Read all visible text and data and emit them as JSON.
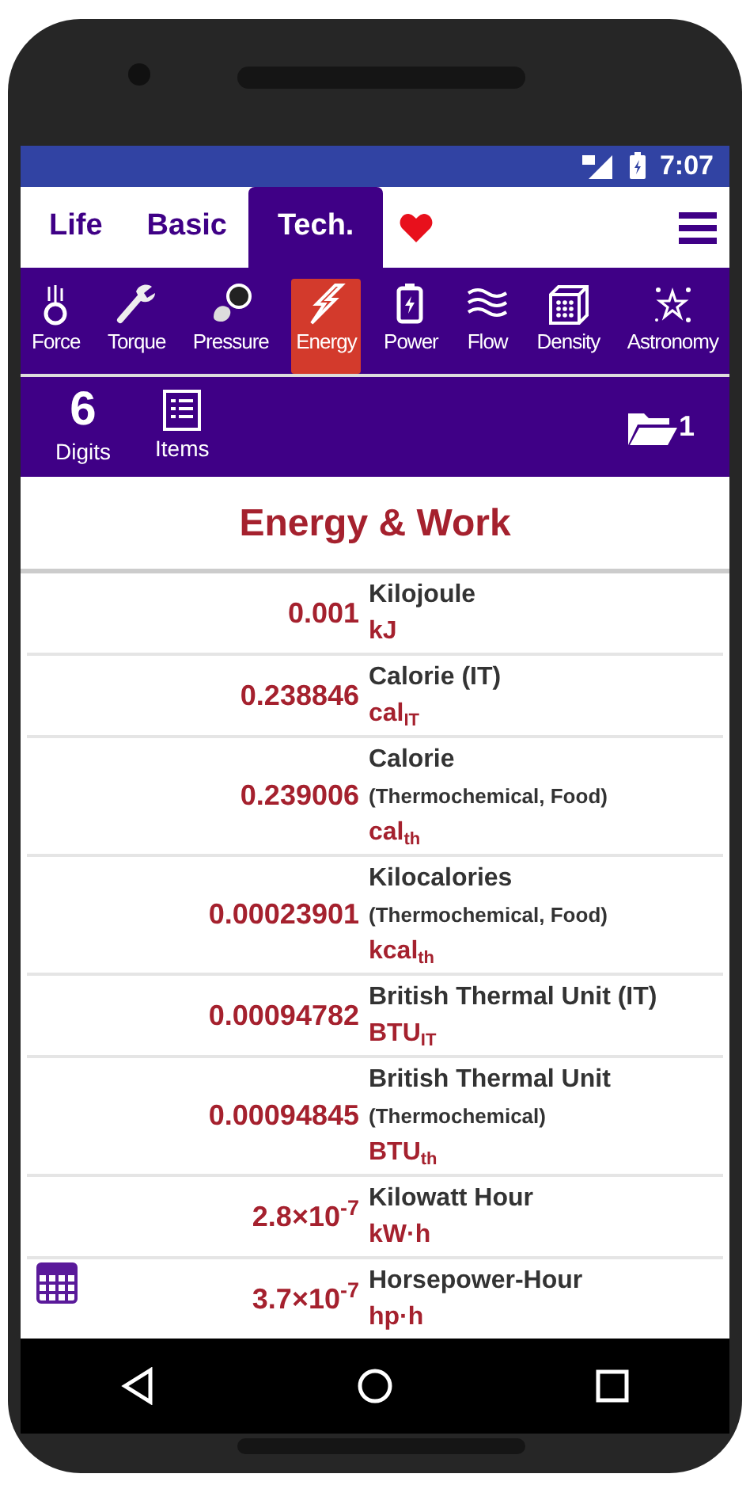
{
  "status_bar": {
    "time": "7:07"
  },
  "tabs": [
    {
      "label": "Life",
      "selected": false
    },
    {
      "label": "Basic",
      "selected": false
    },
    {
      "label": "Tech.",
      "selected": true
    }
  ],
  "categories": [
    {
      "label": "Force",
      "selected": false
    },
    {
      "label": "Torque",
      "selected": false
    },
    {
      "label": "Pressure",
      "selected": false
    },
    {
      "label": "Energy",
      "selected": true
    },
    {
      "label": "Power",
      "selected": false
    },
    {
      "label": "Flow",
      "selected": false
    },
    {
      "label": "Density",
      "selected": false
    },
    {
      "label": "Astronomy",
      "selected": false
    }
  ],
  "toolbar": {
    "digits": "6",
    "digits_label": "Digits",
    "items_label": "Items",
    "folder_count": "1"
  },
  "title": "Energy & Work",
  "units": [
    {
      "value": "0.001",
      "name": "Kilojoule",
      "symbol": "kJ"
    },
    {
      "value": "0.238846",
      "name": "Calorie (IT)",
      "symbol": "cal$_{IT}$"
    },
    {
      "value": "0.239006",
      "name": "Calorie",
      "note": "(Thermochemical, Food)",
      "symbol": "cal$_{th}$"
    },
    {
      "value": "0.00023901",
      "name": "Kilocalories",
      "note": "(Thermochemical, Food)",
      "symbol": "kcal$_{th}$"
    },
    {
      "value": "0.00094782",
      "name": "British Thermal Unit (IT)",
      "symbol": "BTU$_{IT}$"
    },
    {
      "value": "0.00094845",
      "name": "British Thermal Unit",
      "note": "(Thermochemical)",
      "symbol": "BTU$_{th}$"
    },
    {
      "value": "2.8×10$^{-7}$",
      "name": "Kilowatt Hour",
      "symbol": "kW·h"
    },
    {
      "value": "3.7×10$^{-7}$",
      "name": "Horsepower-Hour",
      "symbol": "hp·h"
    }
  ]
}
